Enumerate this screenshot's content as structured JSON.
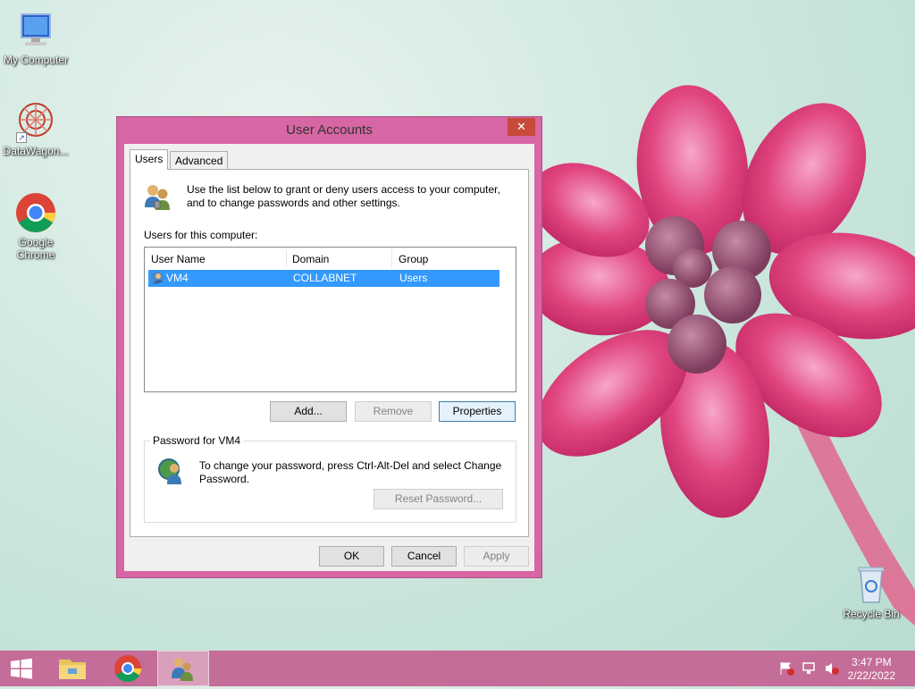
{
  "desktop": {
    "icons": [
      {
        "label": "My Computer"
      },
      {
        "label": "DataWagon..."
      },
      {
        "label": "Google Chrome"
      },
      {
        "label": "Recycle Bin"
      }
    ]
  },
  "dialog": {
    "title": "User Accounts",
    "close_icon": "close-icon",
    "tabs": [
      {
        "label": "Users"
      },
      {
        "label": "Advanced"
      }
    ],
    "intro_text": "Use the list below to grant or deny users access to your computer, and to change passwords and other settings.",
    "users_label": "Users for this computer:",
    "columns": [
      "User Name",
      "Domain",
      "Group"
    ],
    "rows": [
      {
        "user": "VM4",
        "domain": "COLLABNET",
        "group": "Users"
      }
    ],
    "buttons": {
      "add": "Add...",
      "remove": "Remove",
      "properties": "Properties"
    },
    "password_group": {
      "legend": "Password for VM4",
      "text": "To change your password, press Ctrl-Alt-Del and select Change Password.",
      "reset_button": "Reset Password..."
    },
    "footer": {
      "ok": "OK",
      "cancel": "Cancel",
      "apply": "Apply"
    }
  },
  "taskbar": {
    "time": "3:47 PM",
    "date": "2/22/2022"
  },
  "colors": {
    "accent": "#d666a4",
    "selection": "#3399ff",
    "taskbar": "#c46d98"
  }
}
